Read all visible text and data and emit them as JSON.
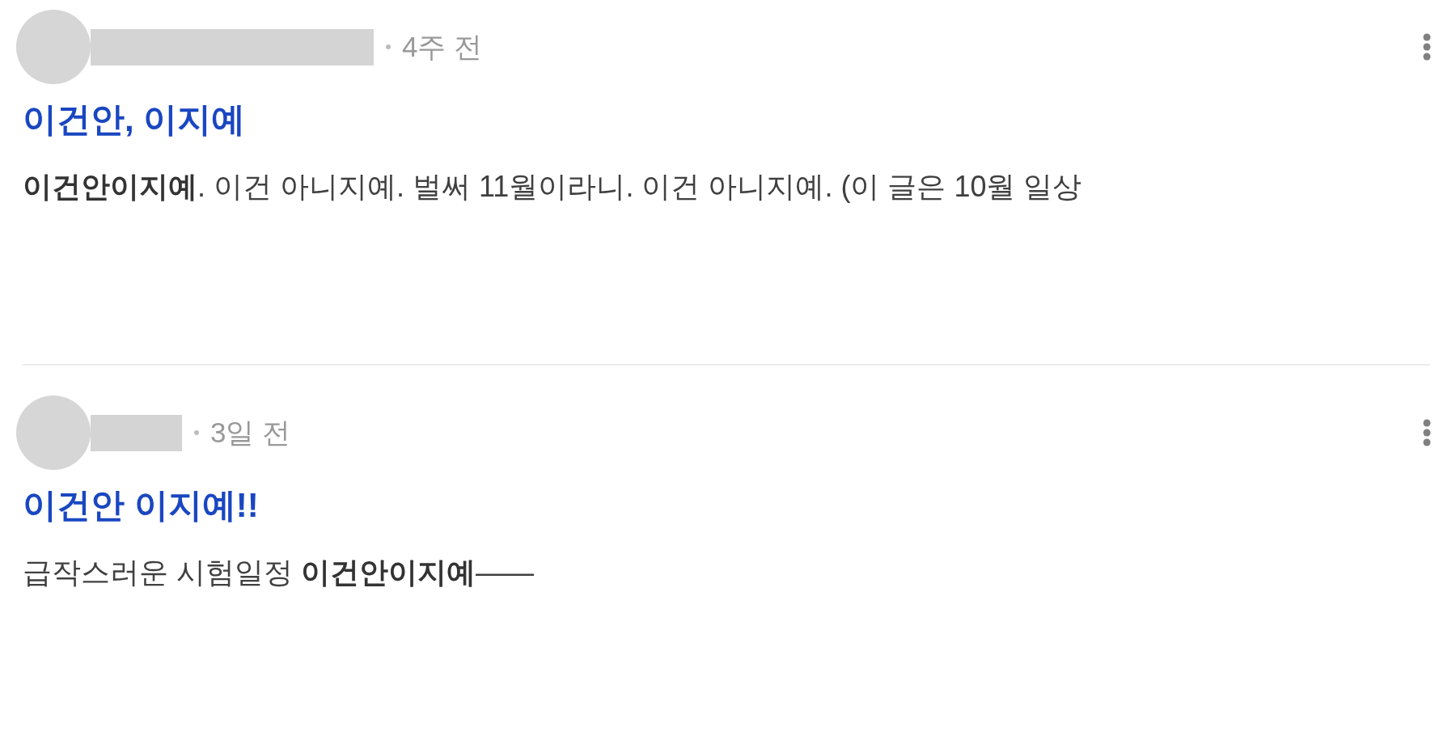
{
  "posts": [
    {
      "time": "4주 전",
      "title": "이건안, 이지예",
      "excerpt": "**이건안이지예**. 이건 아니지예. 벌써 11월이라니. 이건 아니지예. (이 글은 10월 일상"
    },
    {
      "time": "3일 전",
      "title": "이건안 이지예!!",
      "excerpt": "급작스러운 시험일정 **이건안이지예**——"
    }
  ]
}
